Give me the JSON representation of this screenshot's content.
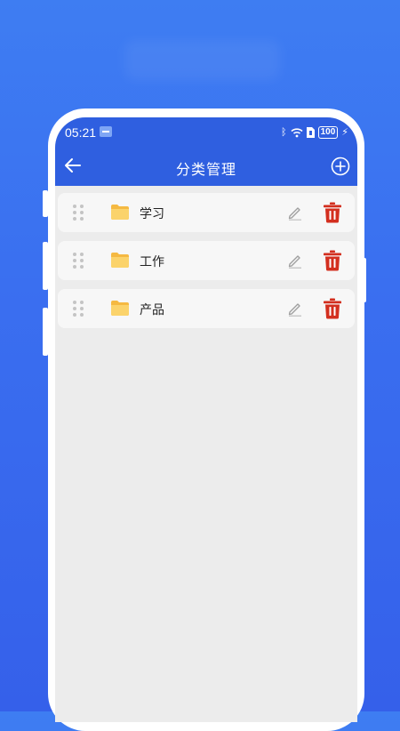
{
  "status_bar": {
    "time": "05:21",
    "battery": "100",
    "icons": [
      "usb-icon",
      "bluetooth-icon",
      "wifi-icon",
      "sim-icon",
      "battery-icon",
      "charging-icon"
    ]
  },
  "header": {
    "title": "分类管理",
    "back_icon": "arrow-left-icon",
    "add_icon": "plus-circle-icon"
  },
  "categories": [
    {
      "label": "学习"
    },
    {
      "label": "工作"
    },
    {
      "label": "产品"
    }
  ],
  "colors": {
    "app_bar": "#2f5fe0",
    "background_gradient": "#3e7df2",
    "list_bg": "#ececec",
    "row_bg": "#f7f7f7",
    "folder": "#f7c85a",
    "trash": "#d32f1f",
    "edit": "#9e9e9e"
  }
}
